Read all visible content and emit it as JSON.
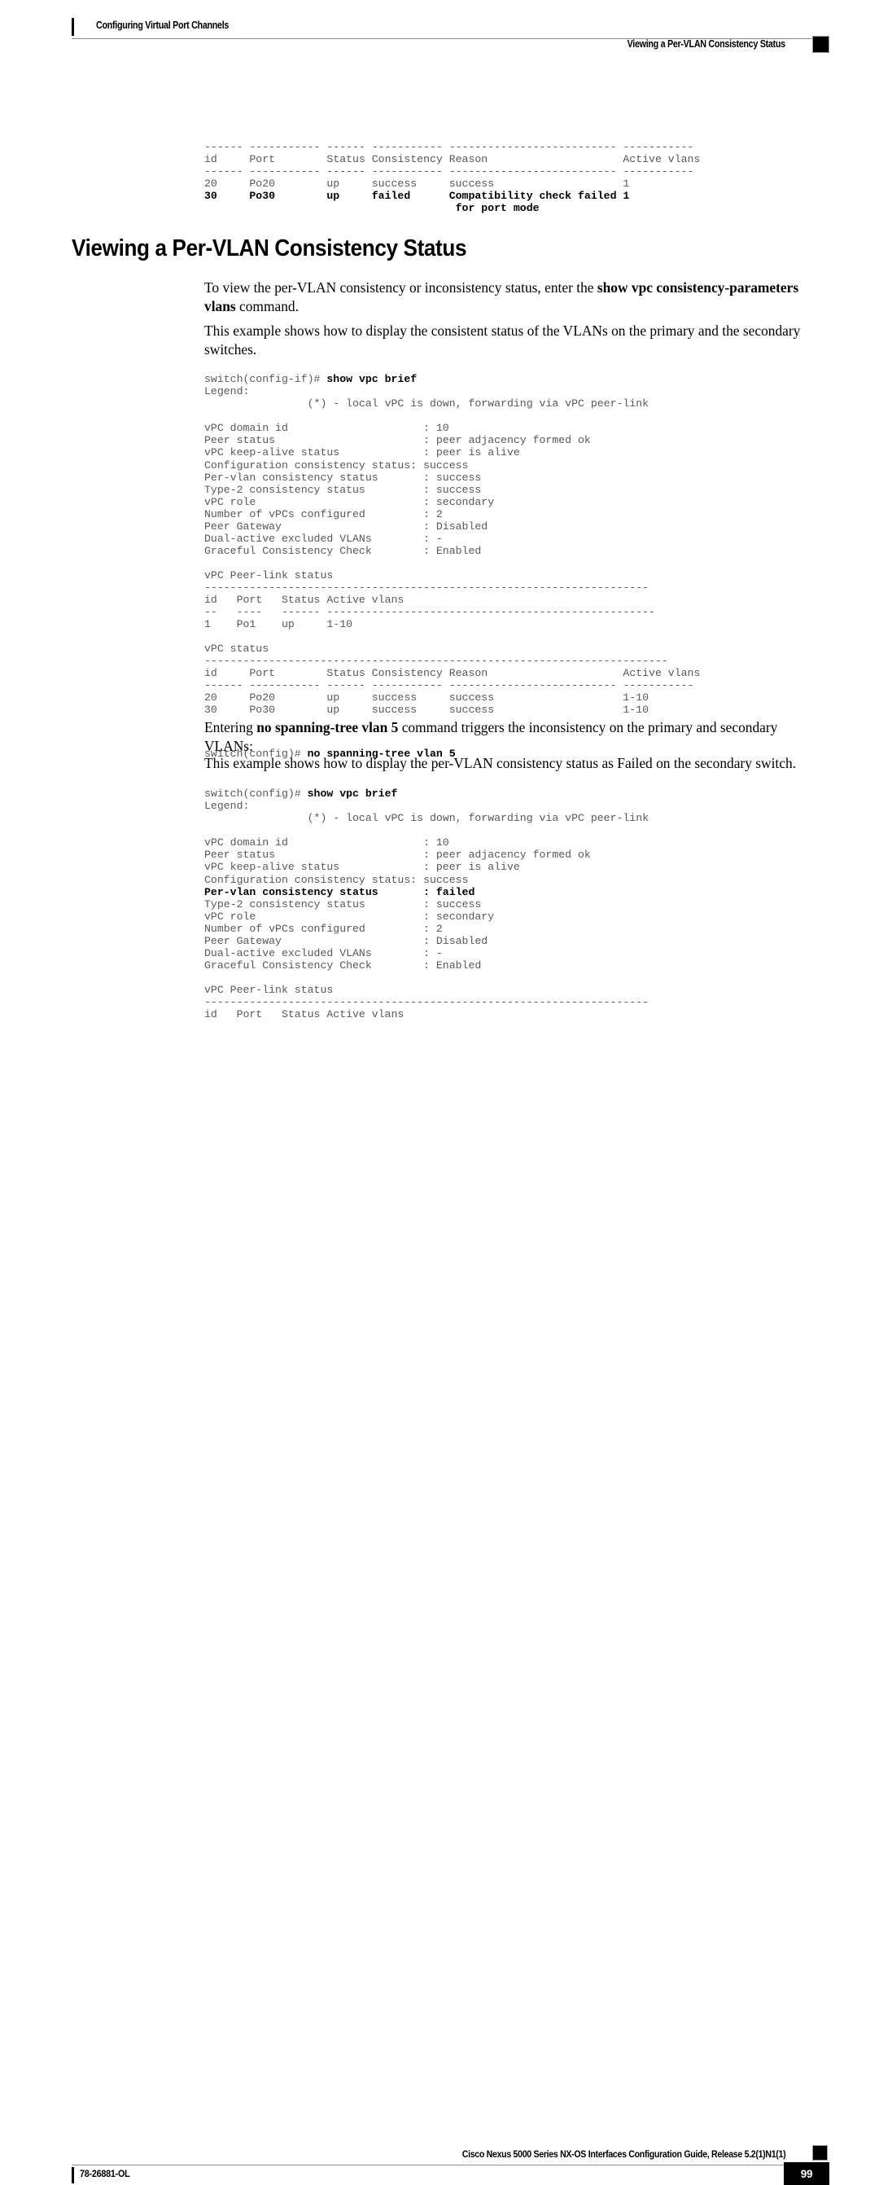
{
  "header": {
    "left_title": "Configuring Virtual Port Channels",
    "right_title": "Viewing a Per-VLAN Consistency Status"
  },
  "footer": {
    "guide_title": "Cisco Nexus 5000 Series NX-OS Interfaces Configuration Guide, Release 5.2(1)N1(1)",
    "doc_number": "78-26881-OL",
    "page_number": "99"
  },
  "section": {
    "title": "Viewing a Per-VLAN Consistency Status"
  },
  "paragraphs": {
    "intro": {
      "pre": "To view the per-VLAN consistency or inconsistency status, enter the ",
      "bold": "show vpc consistency-parameters vlans",
      "post": " command."
    },
    "example_consistent": "This example shows how to display the consistent status of the VLANs on the primary and the secondary switches.",
    "entering": {
      "pre": "Entering ",
      "bold": "no spanning-tree vlan 5",
      "post": " command triggers the inconsistency on the primary and secondary VLANs:"
    },
    "example_failed": "This example shows how to display the per-VLAN consistency status as Failed on the secondary switch."
  },
  "code_blocks": {
    "top_table": {
      "lines": [
        {
          "text": "------ ----------- ------ ----------- -------------------------- -----------",
          "bold_runs": []
        },
        {
          "text": "id     Port        Status Consistency Reason                     Active vlans",
          "bold_runs": []
        },
        {
          "text": "------ ----------- ------ ----------- -------------------------- -----------",
          "bold_runs": []
        },
        {
          "text": "20     Po20        up     success     success                    1",
          "bold_runs": []
        },
        {
          "text": "30     Po30        up     failed      Compatibility check failed 1",
          "bold_runs": [
            [
              0,
              80
            ]
          ]
        },
        {
          "text": "                                       for port mode",
          "bold_runs": [
            [
              0,
              80
            ]
          ]
        }
      ]
    },
    "first_show_vpc_brief": {
      "lines": [
        {
          "text": "switch(config-if)# show vpc brief",
          "bold_runs": [
            [
              19,
              33
            ]
          ]
        },
        {
          "text": "Legend:",
          "bold_runs": []
        },
        {
          "text": "                (*) - local vPC is down, forwarding via vPC peer-link",
          "bold_runs": []
        },
        {
          "text": "",
          "bold_runs": []
        },
        {
          "text": "vPC domain id                     : 10",
          "bold_runs": []
        },
        {
          "text": "Peer status                       : peer adjacency formed ok",
          "bold_runs": []
        },
        {
          "text": "vPC keep-alive status             : peer is alive",
          "bold_runs": []
        },
        {
          "text": "Configuration consistency status: success",
          "bold_runs": []
        },
        {
          "text": "Per-vlan consistency status       : success",
          "bold_runs": []
        },
        {
          "text": "Type-2 consistency status         : success",
          "bold_runs": []
        },
        {
          "text": "vPC role                          : secondary",
          "bold_runs": []
        },
        {
          "text": "Number of vPCs configured         : 2",
          "bold_runs": []
        },
        {
          "text": "Peer Gateway                      : Disabled",
          "bold_runs": []
        },
        {
          "text": "Dual-active excluded VLANs        : -",
          "bold_runs": []
        },
        {
          "text": "Graceful Consistency Check        : Enabled",
          "bold_runs": []
        },
        {
          "text": "",
          "bold_runs": []
        },
        {
          "text": "vPC Peer-link status",
          "bold_runs": []
        },
        {
          "text": "---------------------------------------------------------------------",
          "bold_runs": []
        },
        {
          "text": "id   Port   Status Active vlans",
          "bold_runs": []
        },
        {
          "text": "--   ----   ------ ---------------------------------------------------",
          "bold_runs": []
        },
        {
          "text": "1    Po1    up     1-10",
          "bold_runs": []
        },
        {
          "text": "",
          "bold_runs": []
        },
        {
          "text": "vPC status",
          "bold_runs": []
        },
        {
          "text": "------------------------------------------------------------------------",
          "bold_runs": []
        },
        {
          "text": "id     Port        Status Consistency Reason                     Active vlans",
          "bold_runs": []
        },
        {
          "text": "------ ----------- ------ ----------- -------------------------- -----------",
          "bold_runs": []
        },
        {
          "text": "20     Po20        up     success     success                    1-10",
          "bold_runs": []
        },
        {
          "text": "30     Po30        up     success     success                    1-10",
          "bold_runs": []
        }
      ]
    },
    "no_spanning_tree_cmd": {
      "lines": [
        {
          "text": "switch(config)# no spanning-tree vlan 5",
          "bold_runs": [
            [
              16,
              39
            ]
          ]
        }
      ]
    },
    "second_show_vpc_brief": {
      "lines": [
        {
          "text": "switch(config)# show vpc brief",
          "bold_runs": [
            [
              16,
              30
            ]
          ]
        },
        {
          "text": "Legend:",
          "bold_runs": []
        },
        {
          "text": "                (*) - local vPC is down, forwarding via vPC peer-link",
          "bold_runs": []
        },
        {
          "text": "",
          "bold_runs": []
        },
        {
          "text": "vPC domain id                     : 10",
          "bold_runs": []
        },
        {
          "text": "Peer status                       : peer adjacency formed ok",
          "bold_runs": []
        },
        {
          "text": "vPC keep-alive status             : peer is alive",
          "bold_runs": []
        },
        {
          "text": "Configuration consistency status: success",
          "bold_runs": []
        },
        {
          "text": "Per-vlan consistency status       : failed",
          "bold_runs": [
            [
              0,
              80
            ]
          ]
        },
        {
          "text": "Type-2 consistency status         : success",
          "bold_runs": []
        },
        {
          "text": "vPC role                          : secondary",
          "bold_runs": []
        },
        {
          "text": "Number of vPCs configured         : 2",
          "bold_runs": []
        },
        {
          "text": "Peer Gateway                      : Disabled",
          "bold_runs": []
        },
        {
          "text": "Dual-active excluded VLANs        : -",
          "bold_runs": []
        },
        {
          "text": "Graceful Consistency Check        : Enabled",
          "bold_runs": []
        },
        {
          "text": "",
          "bold_runs": []
        },
        {
          "text": "vPC Peer-link status",
          "bold_runs": []
        },
        {
          "text": "---------------------------------------------------------------------",
          "bold_runs": []
        },
        {
          "text": "id   Port   Status Active vlans",
          "bold_runs": []
        }
      ]
    }
  }
}
